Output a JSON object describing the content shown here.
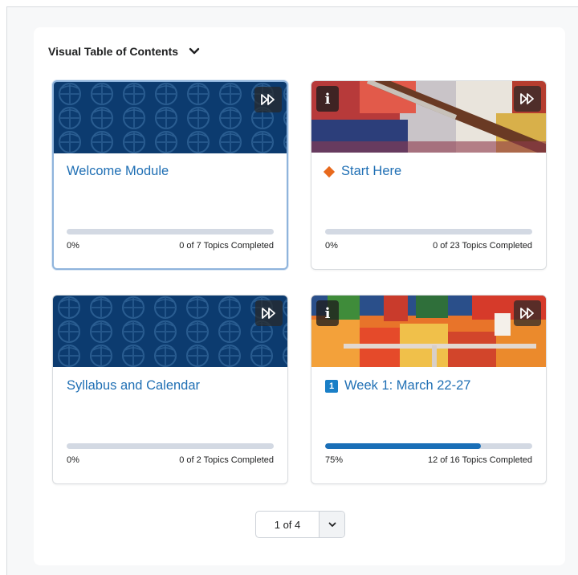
{
  "header": {
    "title": "Visual Table of Contents",
    "chevron_icon": "chevron-down-icon"
  },
  "modules": [
    {
      "title": "Welcome Module",
      "percent_label": "0%",
      "progress": 0,
      "count_label": "0 of 7 Topics Completed",
      "banner": "pattern",
      "badge": ""
    },
    {
      "title": "Start Here",
      "percent_label": "0%",
      "progress": 0,
      "count_label": "0 of 23 Topics Completed",
      "banner": "paintbrush",
      "badge": ""
    },
    {
      "title": "Syllabus and Calendar",
      "percent_label": "0%",
      "progress": 0,
      "count_label": "0 of 2 Topics Completed",
      "banner": "pattern",
      "badge": ""
    },
    {
      "title": "Week 1: March 22-27",
      "percent_label": "75%",
      "progress": 0.75,
      "count_label": "12 of 16 Topics Completed",
      "banner": "paint",
      "badge": "1"
    }
  ],
  "pager": {
    "value": "1 of 4"
  },
  "colors": {
    "link": "#1f6fb4",
    "progress": "#1a6fb7",
    "banner_navy": "#0c3b6f",
    "diamond": "#e8691c"
  }
}
